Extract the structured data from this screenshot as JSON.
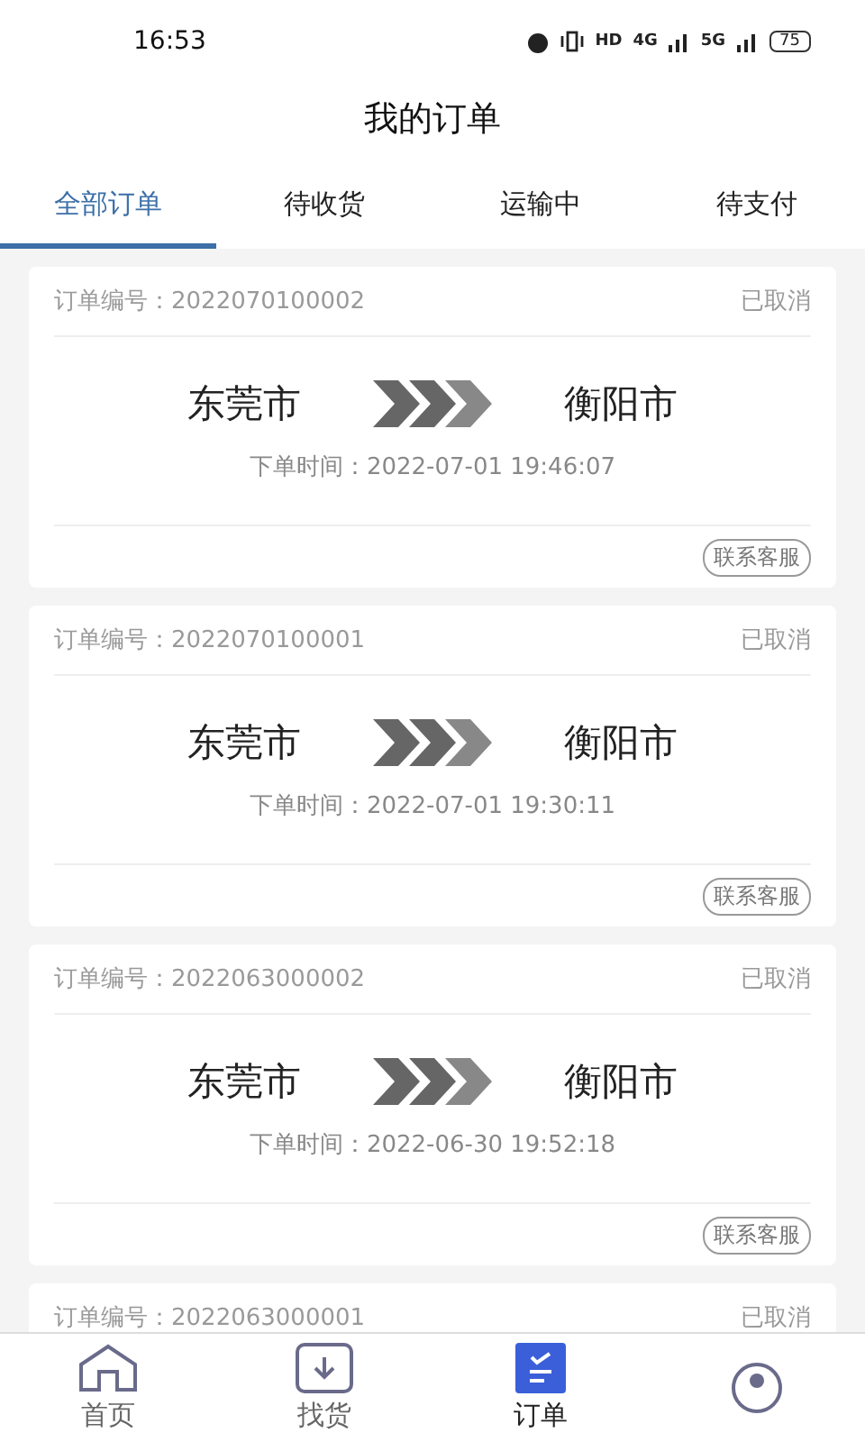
{
  "status_bar": {
    "time": "16:53",
    "hd": "HD",
    "net1": "4G",
    "net2": "5G",
    "battery": "75"
  },
  "header": {
    "title": "我的订单"
  },
  "tabs": [
    {
      "label": "全部订单",
      "selected": true
    },
    {
      "label": "待收货",
      "selected": false
    },
    {
      "label": "运输中",
      "selected": false
    },
    {
      "label": "待支付",
      "selected": false
    }
  ],
  "orders": [
    {
      "number_label": "订单编号：",
      "number": "2022070100002",
      "status": "已取消",
      "from": "东莞市",
      "to": "衡阳市",
      "time_label": "下单时间：",
      "time": "2022-07-01 19:46:07",
      "action": "联系客服"
    },
    {
      "number_label": "订单编号：",
      "number": "2022070100001",
      "status": "已取消",
      "from": "东莞市",
      "to": "衡阳市",
      "time_label": "下单时间：",
      "time": "2022-07-01 19:30:11",
      "action": "联系客服"
    },
    {
      "number_label": "订单编号：",
      "number": "2022063000002",
      "status": "已取消",
      "from": "东莞市",
      "to": "衡阳市",
      "time_label": "下单时间：",
      "time": "2022-06-30 19:52:18",
      "action": "联系客服"
    },
    {
      "number_label": "订单编号：",
      "number": "2022063000001",
      "status": "已取消"
    }
  ],
  "nav": [
    {
      "kind": "home",
      "label": "首页",
      "selected": false
    },
    {
      "kind": "goods",
      "label": "找货",
      "selected": false
    },
    {
      "kind": "orders",
      "label": "订单",
      "selected": true
    },
    {
      "kind": "user",
      "selected": false
    }
  ]
}
